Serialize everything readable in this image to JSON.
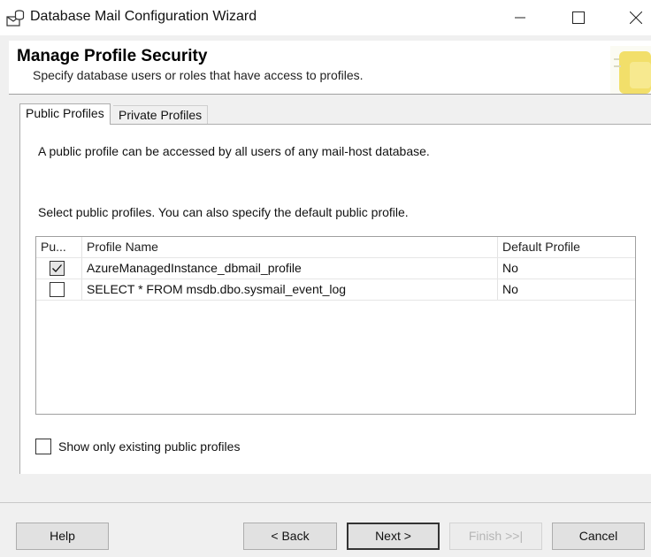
{
  "window": {
    "title": "Database Mail Configuration Wizard",
    "icon": "database-mail-icon"
  },
  "header": {
    "title": "Manage Profile Security",
    "subtitle": "Specify database users or roles that have access to profiles."
  },
  "tabs": [
    {
      "label": "Public Profiles",
      "active": true
    },
    {
      "label": "Private Profiles",
      "active": false
    }
  ],
  "panel": {
    "description": "A public profile can be accessed by all users of any mail-host database.",
    "instruction": "Select public profiles. You can also specify the default public profile."
  },
  "grid": {
    "columns": [
      "Pu...",
      "Profile Name",
      "Default Profile"
    ],
    "rows": [
      {
        "public": true,
        "profile_name": "AzureManagedInstance_dbmail_profile",
        "default_profile": "No"
      },
      {
        "public": false,
        "profile_name": "SELECT * FROM msdb.dbo.sysmail_event_log",
        "default_profile": "No"
      }
    ]
  },
  "show_existing": {
    "label": "Show only existing public profiles",
    "checked": false
  },
  "buttons": {
    "help": "Help",
    "back": "< Back",
    "next": "Next >",
    "finish": "Finish >>|",
    "cancel": "Cancel"
  },
  "colors": {
    "window_bg": "#f0f0f0",
    "button_bg": "#e1e1e1",
    "disabled_text": "#b5b5b5"
  }
}
